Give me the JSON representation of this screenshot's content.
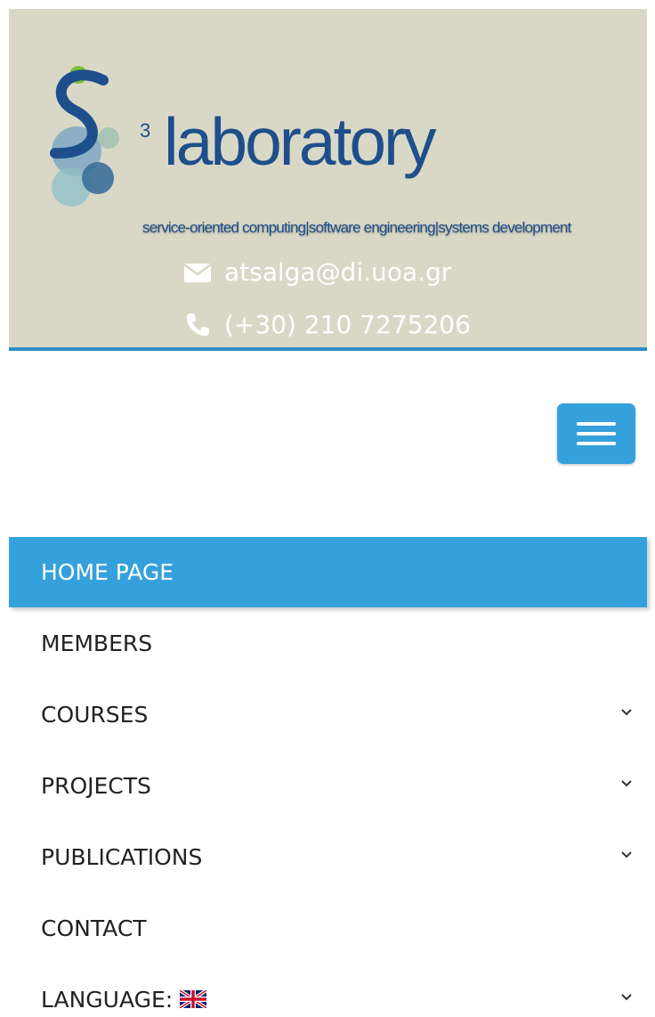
{
  "header": {
    "logo": {
      "superscript": "3",
      "wordmark": "laboratory",
      "tagline": "service-oriented computing|software engineering|systems development"
    },
    "email": "atsalga@di.uoa.gr",
    "phone": "(+30) 210 7275206",
    "background_color": "#d9d8c6",
    "rule_color": "#2e8ec5"
  },
  "nav": {
    "toggle_icon": "hamburger-menu-icon",
    "accent_color": "#35a1dc",
    "items": [
      {
        "label": "HOME PAGE",
        "active": true,
        "has_submenu": false
      },
      {
        "label": "MEMBERS",
        "active": false,
        "has_submenu": false
      },
      {
        "label": "COURSES",
        "active": false,
        "has_submenu": true
      },
      {
        "label": "PROJECTS",
        "active": false,
        "has_submenu": true
      },
      {
        "label": "PUBLICATIONS",
        "active": false,
        "has_submenu": true
      },
      {
        "label": "CONTACT",
        "active": false,
        "has_submenu": false
      },
      {
        "label": "LANGUAGE:",
        "active": false,
        "has_submenu": true,
        "icon": "uk-flag-icon"
      }
    ]
  }
}
